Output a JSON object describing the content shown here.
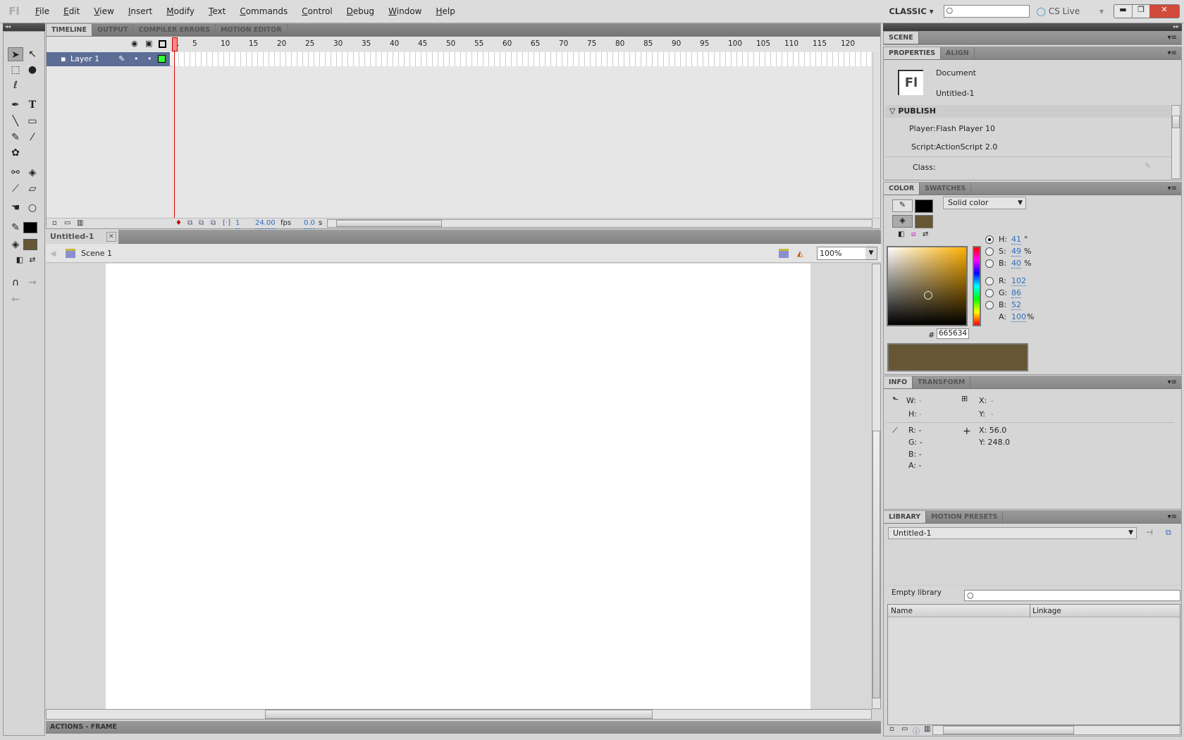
{
  "app": {
    "logo": "Fl",
    "menus": [
      "File",
      "Edit",
      "View",
      "Insert",
      "Modify",
      "Text",
      "Commands",
      "Control",
      "Debug",
      "Window",
      "Help"
    ],
    "workspace": "CLASSIC",
    "search_placeholder": "",
    "cs_live": "CS Live"
  },
  "timeline": {
    "tabs": [
      "TIMELINE",
      "OUTPUT",
      "COMPILER ERRORS",
      "MOTION EDITOR"
    ],
    "ruler": [
      1,
      5,
      10,
      15,
      20,
      25,
      30,
      35,
      40,
      45,
      50,
      55,
      60,
      65,
      70,
      75,
      80,
      85,
      90,
      95,
      100,
      105,
      110,
      115,
      120
    ],
    "layer": "Layer 1",
    "current_frame": "1",
    "fps": "24.00",
    "fps_unit": "fps",
    "time": "0.0",
    "time_unit": "s"
  },
  "document": {
    "tab": "Untitled-1",
    "scene": "Scene 1",
    "zoom": "100%"
  },
  "actions_bar": "ACTIONS - FRAME",
  "scene_panel": {
    "tab": "SCENE"
  },
  "properties": {
    "tabs": [
      "PROPERTIES",
      "ALIGN"
    ],
    "icon_text": "Fl",
    "type": "Document",
    "name": "Untitled-1",
    "section": "PUBLISH",
    "player_label": "Player:",
    "player": "Flash Player 10",
    "script_label": "Script:",
    "script": "ActionScript 2.0",
    "class_label": "Class:"
  },
  "color": {
    "tabs": [
      "COLOR",
      "SWATCHES"
    ],
    "type": "Solid color",
    "stroke_color": "#000000",
    "fill_color": "#665634",
    "h": "41",
    "h_unit": "°",
    "s": "49",
    "b": "40",
    "pct": "%",
    "r": "102",
    "g": "86",
    "bl": "52",
    "a": "100",
    "hex": "665634",
    "labels": {
      "h": "H:",
      "s": "S:",
      "b": "B:",
      "r": "R:",
      "g": "G:",
      "bl": "B:",
      "a": "A:",
      "hash": "#"
    }
  },
  "info": {
    "tabs": [
      "INFO",
      "TRANSFORM"
    ],
    "w": "W:",
    "h": "H:",
    "x": "X:",
    "y": "Y:",
    "dash": "-",
    "r": "R: -",
    "g": "G: -",
    "b": "B: -",
    "a": "A: -",
    "cx": "X: 56.0",
    "cy": "Y: 248.0"
  },
  "library": {
    "tabs": [
      "LIBRARY",
      "MOTION PRESETS"
    ],
    "doc": "Untitled-1",
    "status": "Empty library",
    "columns": [
      "Name",
      "Linkage"
    ]
  }
}
